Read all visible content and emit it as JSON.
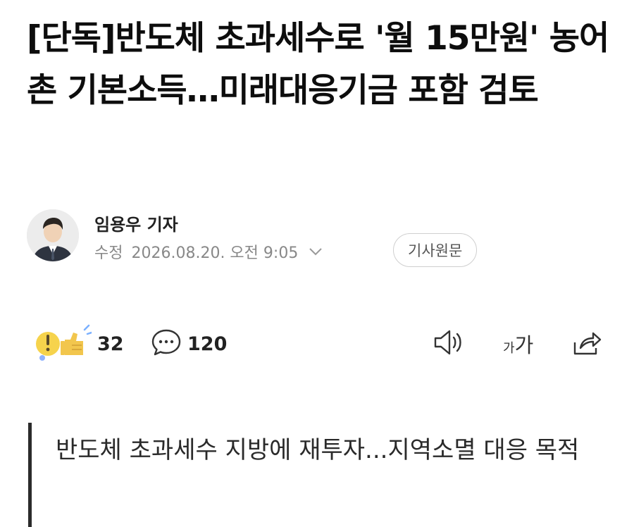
{
  "article": {
    "headline": "[단독]반도체 초과세수로 '월 15만원' 농어촌 기본소득…미래대응기금 포함 검토",
    "author": "임용우 기자",
    "meta_label": "수정",
    "timestamp": "2026.08.20. 오전 9:05",
    "original_link": "기사원문",
    "subheading": "반도체 초과세수 지방에 재투자...지역소멸 대응 목적"
  },
  "reactions": {
    "reaction_count": "32",
    "comment_count": "120"
  },
  "toolbar": {
    "font_size_label_small": "가",
    "font_size_label_large": "가"
  },
  "icons": [
    "reaction-emoji-icon",
    "comment-icon",
    "speaker-icon",
    "font-size-icon",
    "share-icon",
    "chevron-down-icon"
  ],
  "colors": {
    "text": "#111111",
    "meta": "#888888",
    "quote_bar": "#2b2b2b"
  }
}
